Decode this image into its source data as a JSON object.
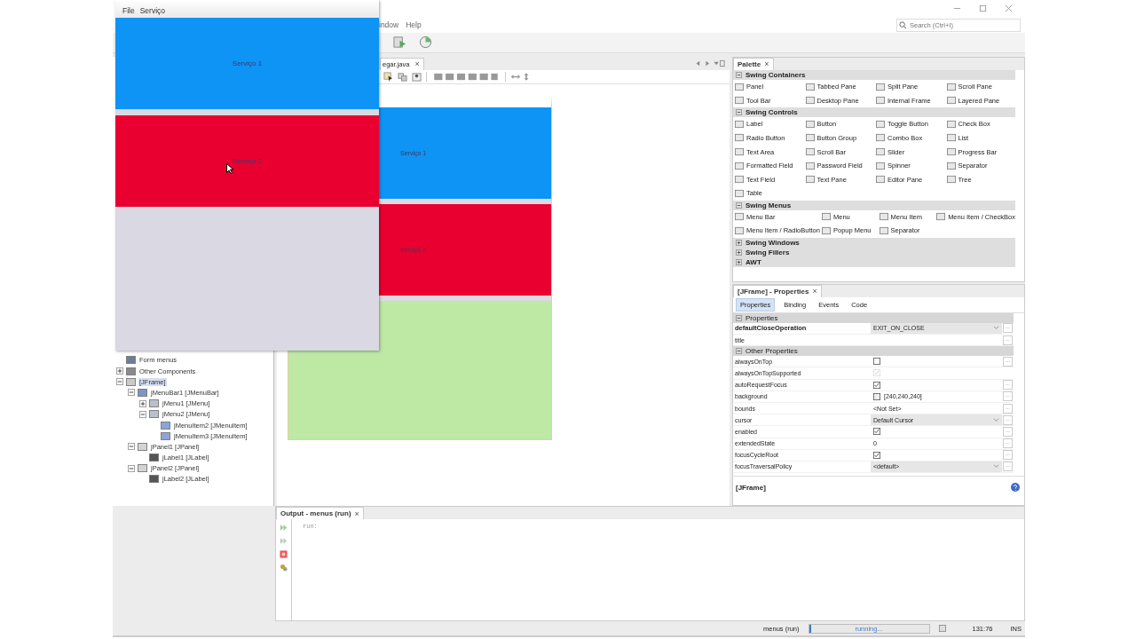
{
  "app_window": {
    "menus": [
      {
        "label": "File"
      },
      {
        "label": "Serviço"
      }
    ],
    "panels": [
      {
        "label": "Serviço 1",
        "color": "#0d94f5"
      },
      {
        "label": "Serviço 2",
        "color": "#ea0030"
      }
    ]
  },
  "ide": {
    "menu": [
      {
        "label": "indow"
      },
      {
        "label": "Help"
      }
    ],
    "search": {
      "placeholder": "Search (Ctrl+I)"
    }
  },
  "editor": {
    "tab": {
      "label": "egar.java",
      "close": "×"
    },
    "form_preview": {
      "panels": [
        {
          "label": "Serviço 1",
          "color": "#0d94f5"
        },
        {
          "label": "Serviço 2",
          "color": "#ea0030"
        },
        {
          "color": "#bde9a5"
        }
      ]
    }
  },
  "navigator": {
    "tree": [
      {
        "label": "Form menus",
        "kind": "form"
      },
      {
        "label": "Other Components",
        "kind": "folder",
        "expanded": false
      },
      {
        "label": "[JFrame]",
        "kind": "frame",
        "expanded": true,
        "selected": true,
        "children": [
          {
            "label": "jMenuBar1 [JMenuBar]",
            "kind": "menubar",
            "expanded": true,
            "selected": false,
            "children": [
              {
                "label": "jMenu1 [JMenu]",
                "kind": "menu",
                "expanded": false,
                "selected": false
              },
              {
                "label": "jMenu2 [JMenu]",
                "kind": "menu",
                "expanded": true,
                "selected": false,
                "children": [
                  {
                    "label": "jMenuItem2 [JMenuItem]",
                    "kind": "menuitem",
                    "selected": false
                  },
                  {
                    "label": "jMenuItem3 [JMenuItem]",
                    "kind": "menuitem",
                    "selected": false
                  }
                ]
              }
            ]
          },
          {
            "label": "jPanel1 [JPanel]",
            "kind": "panel",
            "expanded": true,
            "selected": false,
            "children": [
              {
                "label": "jLabel1 [JLabel]",
                "kind": "label",
                "selected": false
              }
            ]
          },
          {
            "label": "jPanel2 [JPanel]",
            "kind": "panel",
            "expanded": true,
            "selected": false,
            "children": [
              {
                "label": "jLabel2 [JLabel]",
                "kind": "label",
                "selected": false
              }
            ]
          }
        ]
      }
    ]
  },
  "palette": {
    "title": "Palette",
    "close": "×",
    "categories": [
      {
        "name": "Swing Containers",
        "expanded": true,
        "items": [
          "Panel",
          "Tabbed Pane",
          "Split Pane",
          "Scroll Pane",
          "Tool Bar",
          "Desktop Pane",
          "Internal Frame",
          "Layered Pane"
        ]
      },
      {
        "name": "Swing Controls",
        "expanded": true,
        "items": [
          "Label",
          "Button",
          "Toggle Button",
          "Check Box",
          "Radio Button",
          "Button Group",
          "Combo Box",
          "List",
          "Text Area",
          "Scroll Bar",
          "Slider",
          "Progress Bar",
          "Formatted Field",
          "Password Field",
          "Spinner",
          "Separator",
          "Text Field",
          "Text Pane",
          "Editor Pane",
          "Tree",
          "Table"
        ]
      },
      {
        "name": "Swing Menus",
        "expanded": true,
        "items": [
          "Menu Bar",
          "Menu",
          "Menu Item",
          "Menu Item / CheckBox",
          "Menu Item / RadioButton",
          "Popup Menu",
          "Separator"
        ]
      },
      {
        "name": "Swing Windows",
        "expanded": false
      },
      {
        "name": "Swing Fillers",
        "expanded": false
      },
      {
        "name": "AWT",
        "expanded": false
      }
    ]
  },
  "properties": {
    "title": "[JFrame] - Properties",
    "close": "×",
    "tabs": [
      {
        "label": "Properties",
        "selected": true
      },
      {
        "label": "Binding",
        "selected": false
      },
      {
        "label": "Events",
        "selected": false
      },
      {
        "label": "Code",
        "selected": false
      }
    ],
    "sections": [
      {
        "name": "Properties",
        "expanded": true,
        "rows": [
          {
            "name": "defaultCloseOperation",
            "kind": "combo",
            "value": "EXIT_ON_CLOSE",
            "modified": true,
            "button": "..."
          },
          {
            "name": "title",
            "kind": "text",
            "modified": false,
            "button": "..."
          }
        ]
      },
      {
        "name": "Other Properties",
        "expanded": true,
        "rows": [
          {
            "name": "alwaysOnTop",
            "kind": "checkbox",
            "checked": false,
            "disabled": false,
            "modified": false,
            "button": "..."
          },
          {
            "name": "alwaysOnTopSupported",
            "kind": "checkbox",
            "checked": true,
            "disabled": true,
            "modified": false
          },
          {
            "name": "autoRequestFocus",
            "kind": "checkbox",
            "checked": true,
            "disabled": false,
            "modified": false,
            "button": "..."
          },
          {
            "name": "background",
            "kind": "color",
            "value": "[240,240,240]",
            "modified": false,
            "button": "..."
          },
          {
            "name": "bounds",
            "kind": "text",
            "value": "<Not Set>",
            "modified": false,
            "button": "..."
          },
          {
            "name": "cursor",
            "kind": "combo",
            "value": "Default Cursor",
            "modified": false,
            "button": "..."
          },
          {
            "name": "enabled",
            "kind": "checkbox",
            "checked": true,
            "disabled": false,
            "modified": false,
            "button": "..."
          },
          {
            "name": "extendedState",
            "kind": "text",
            "value": "0",
            "modified": false,
            "button": "..."
          },
          {
            "name": "focusCycleRoot",
            "kind": "checkbox",
            "checked": true,
            "disabled": false,
            "modified": false,
            "button": "..."
          },
          {
            "name": "focusTraversalPolicy",
            "kind": "combo",
            "value": "<default>",
            "modified": false,
            "button": "..."
          }
        ]
      }
    ],
    "footer": "[JFrame]"
  },
  "output": {
    "title": "Output - menus (run)",
    "close": "×",
    "lines": [
      "run:"
    ]
  },
  "status_bar": {
    "task": "menus (run)",
    "progress": {
      "label": "running...",
      "level": 0.02
    },
    "position": "131:76",
    "mode": "INS"
  }
}
